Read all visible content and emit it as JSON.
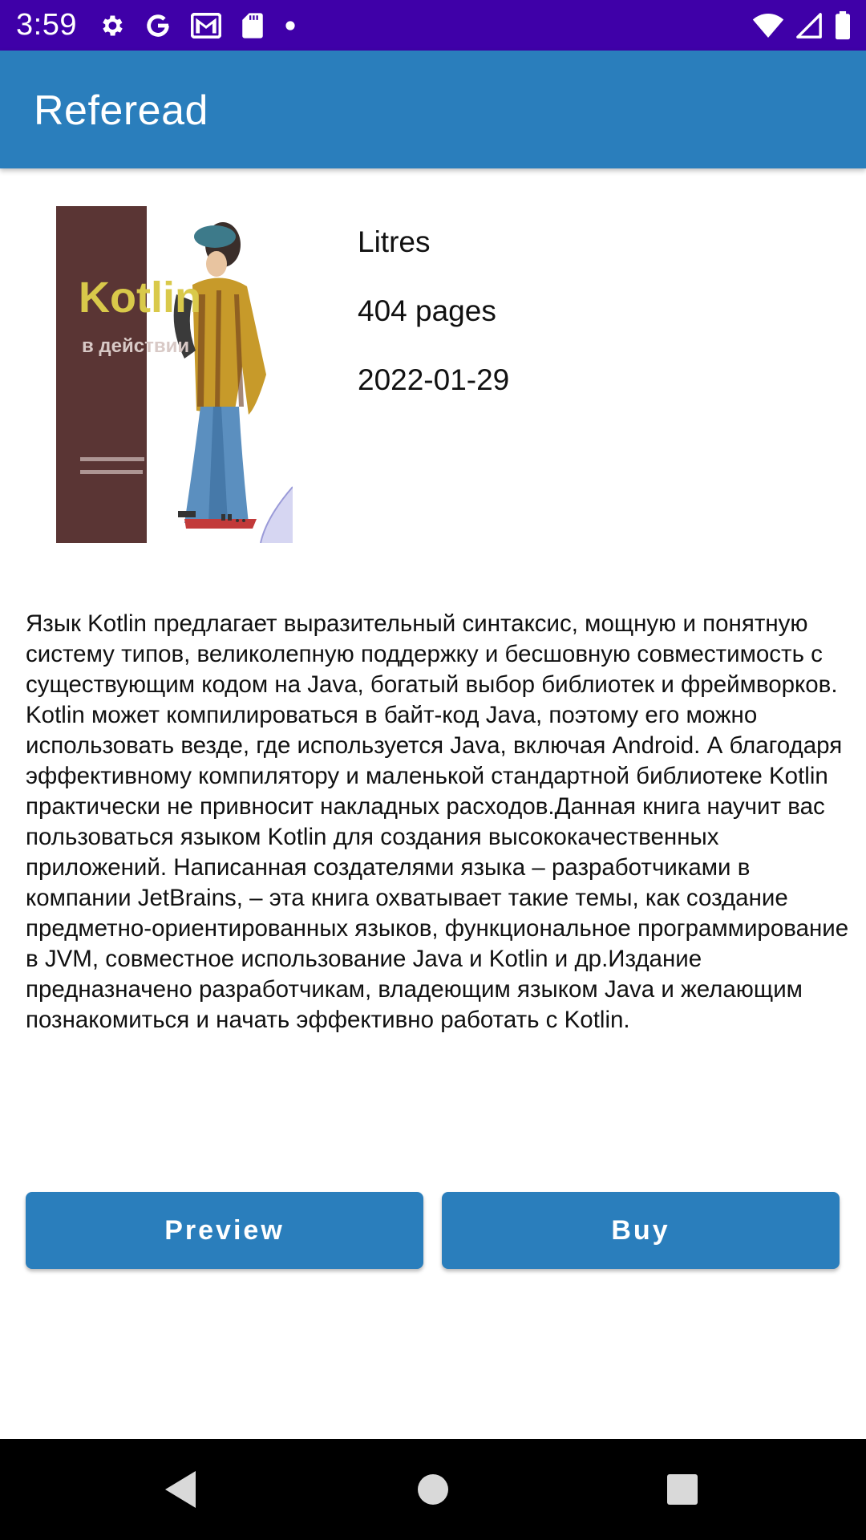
{
  "status_bar": {
    "time": "3:59",
    "left_icons": [
      "settings-gear-icon",
      "google-g-icon",
      "gmail-icon",
      "sd-card-icon",
      "notification-dot-icon"
    ],
    "right_icons": [
      "wifi-icon",
      "cellular-signal-icon",
      "battery-icon"
    ],
    "background_color": "#3f00a8"
  },
  "app_bar": {
    "title": "Referead",
    "background_color": "#2a7ebc"
  },
  "book": {
    "cover": {
      "title": "Kotlin",
      "subtitle": "в действии"
    },
    "publisher": "Litres",
    "pages": "404 pages",
    "date": "2022-01-29",
    "description": "Язык Kotlin предлагает выразительный синтаксис, мощную и понятную систему типов, великолепную поддержку и бесшовную совместимость с существующим кодом на Java, богатый выбор библиотек и фреймворков. Kotlin может компилироваться в байт-код Java, поэтому его можно использовать везде, где используется Java, включая Android. А благодаря эффективному компилятору и маленькой стандартной библиотеке Kotlin практически не привносит накладных расходов.Данная книга научит вас пользоваться языком Kotlin для создания высококачественных приложений. Написанная создателями языка – разработчиками в компании JetBrains, – эта книга охватывает такие темы, как создание предметно-ориентированных языков, функциональное программирование в JVM, совместное использование Java и Kotlin и др.Издание предназначено разработчикам, владеющим языком Java и желающим познакомиться и начать эффективно работать с Kotlin."
  },
  "actions": {
    "preview_label": "Preview",
    "buy_label": "Buy"
  },
  "nav_bar": {
    "icons": [
      "back-icon",
      "home-icon",
      "recents-icon"
    ]
  }
}
